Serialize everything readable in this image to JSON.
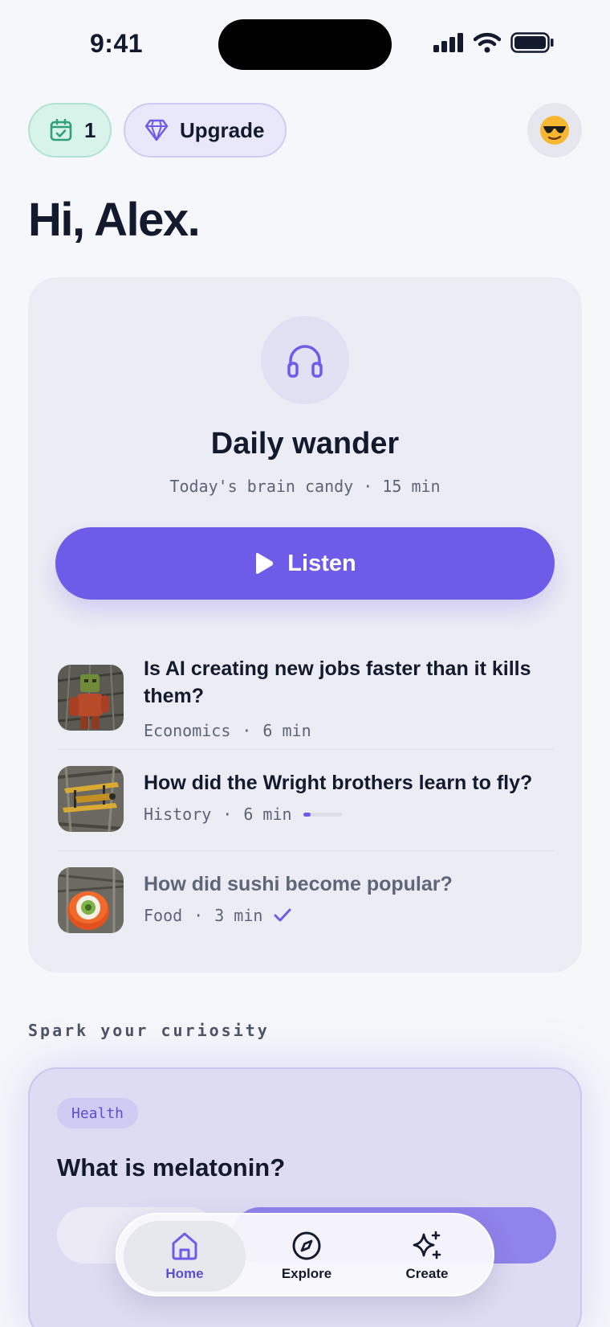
{
  "status_bar": {
    "time": "9:41"
  },
  "header": {
    "streak_count": "1",
    "upgrade_label": "Upgrade",
    "avatar_emoji": "😎"
  },
  "greeting": "Hi, Alex.",
  "daily": {
    "title": "Daily wander",
    "subtitle": "Today's brain candy · 15 min",
    "listen_label": "Listen",
    "episodes": [
      {
        "title": "Is AI creating new jobs faster than it kills them?",
        "category": "Economics",
        "duration": "6 min",
        "status": "new"
      },
      {
        "title": "How did the Wright brothers learn to fly?",
        "category": "History",
        "duration": "6 min",
        "status": "in-progress",
        "progress": 0.2
      },
      {
        "title": "How did sushi become popular?",
        "category": "Food",
        "duration": "3 min",
        "status": "completed"
      }
    ]
  },
  "spark": {
    "section_label": "Spark your curiosity",
    "topic": "Health",
    "question": "What is melatonin?"
  },
  "nav": {
    "items": [
      {
        "label": "Home",
        "icon": "home-icon",
        "active": true
      },
      {
        "label": "Explore",
        "icon": "compass-icon",
        "active": false
      },
      {
        "label": "Create",
        "icon": "sparkle-icon",
        "active": false
      }
    ]
  },
  "colors": {
    "accent": "#6c5ce7",
    "background": "#f6f7fb",
    "card": "#ecedf4",
    "streak_bg": "#d8f3ea",
    "streak_icon": "#2fa07a",
    "text": "#141a2e",
    "muted": "#5d6478"
  }
}
